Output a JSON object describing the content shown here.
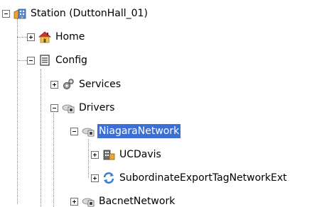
{
  "tree": {
    "station": {
      "label": "Station (DuttonHall_01)",
      "icon": "station-icon",
      "expanded": true
    },
    "home": {
      "label": "Home",
      "icon": "home-icon",
      "expanded": false
    },
    "config": {
      "label": "Config",
      "icon": "config-icon",
      "expanded": true
    },
    "services": {
      "label": "Services",
      "icon": "gears-icon",
      "expanded": false
    },
    "drivers": {
      "label": "Drivers",
      "icon": "drivers-icon",
      "expanded": true
    },
    "niagara_network": {
      "label": "NiagaraNetwork",
      "icon": "network-icon",
      "expanded": true,
      "selected": true
    },
    "ucdavis": {
      "label": "UCDavis",
      "icon": "station-device-icon",
      "expanded": false
    },
    "subordinate_export": {
      "label": "SubordinateExportTagNetworkExt",
      "icon": "sync-icon",
      "expanded": false
    },
    "bacnet_network": {
      "label": "BacnetNetwork",
      "icon": "network-icon",
      "expanded": false
    }
  },
  "colors": {
    "selection": "#3b6fd5",
    "connector": "#8a8a8a"
  }
}
